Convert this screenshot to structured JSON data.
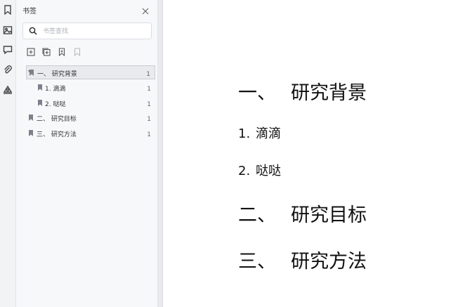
{
  "panel": {
    "title": "书签",
    "search_placeholder": "书签查找"
  },
  "bookmarks": [
    {
      "label": "一、 研究背景",
      "page": "1",
      "level": 0,
      "selected": true,
      "expanded": true
    },
    {
      "label": "1. 滴滴",
      "page": "1",
      "level": 1
    },
    {
      "label": "2. 哒哒",
      "page": "1",
      "level": 1
    },
    {
      "label": "二、 研究目标",
      "page": "1",
      "level": 0
    },
    {
      "label": "三、 研究方法",
      "page": "1",
      "level": 0
    }
  ],
  "document": {
    "h1_1_num": "一、",
    "h1_1_text": "研究背景",
    "h2_1_num": "1.",
    "h2_1_text": "滴滴",
    "h2_2_num": "2.",
    "h2_2_text": "哒哒",
    "h1_2_num": "二、",
    "h1_2_text": "研究目标",
    "h1_3_num": "三、",
    "h1_3_text": "研究方法"
  },
  "icons": {
    "rail": [
      "bookmark-icon",
      "image-icon",
      "comment-icon",
      "attachment-icon",
      "signature-icon"
    ],
    "toolbar": [
      "add-bookmark-icon",
      "add-sub-bookmark-icon",
      "bookmark-icon",
      "bookmark-disabled-icon"
    ]
  }
}
